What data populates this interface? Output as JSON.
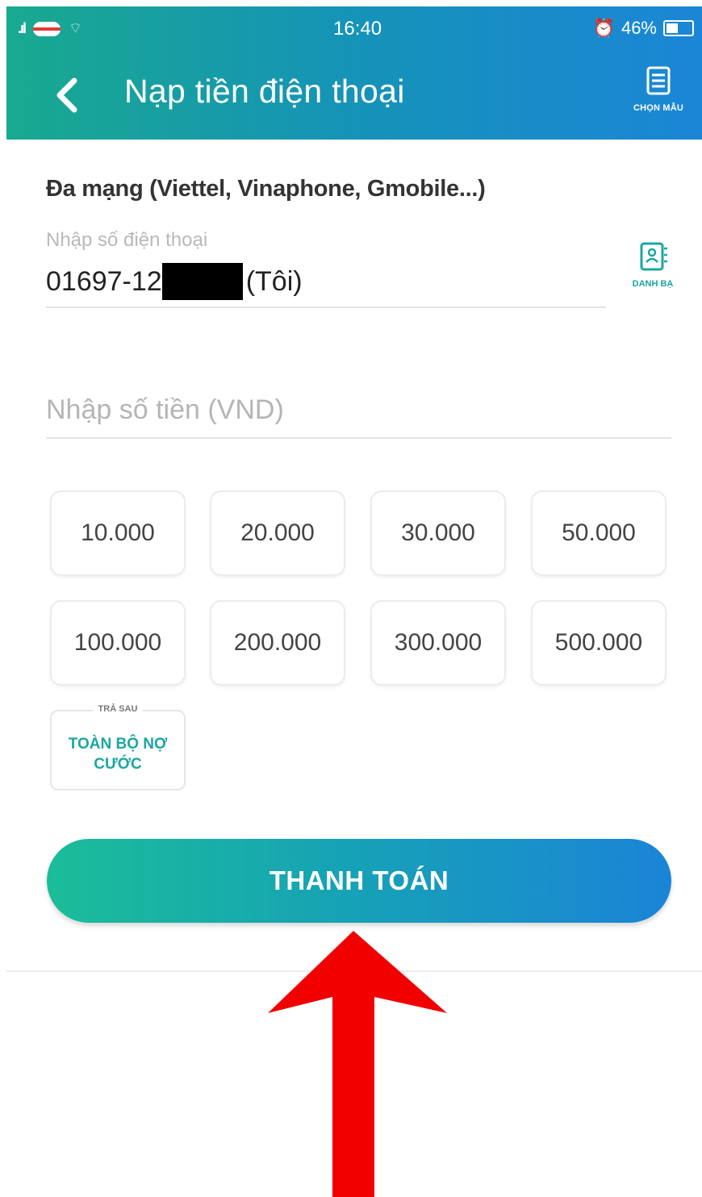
{
  "status_bar": {
    "time": "16:40",
    "battery": "46%"
  },
  "header": {
    "title": "Nạp tiền điện thoại",
    "template_label": "CHỌN MẪU"
  },
  "form": {
    "network_label": "Đa mạng (Viettel, Vinaphone, Gmobile...)",
    "phone_hint": "Nhập số điện thoại",
    "phone_prefix": "01697-12",
    "phone_suffix": "(Tôi)",
    "contacts_label": "DANH BẠ",
    "amount_placeholder": "Nhập số tiền (VND)"
  },
  "amounts": [
    "10.000",
    "20.000",
    "30.000",
    "50.000",
    "100.000",
    "200.000",
    "300.000",
    "500.000"
  ],
  "debt_option": {
    "tag": "TRẢ SAU",
    "label": "TOÀN BỘ NỢ CƯỚC"
  },
  "pay_button": "THANH TOÁN",
  "colors": {
    "accent_teal": "#1aa7a0",
    "accent_blue": "#1b86d6",
    "annotation_arrow": "#f20000"
  }
}
